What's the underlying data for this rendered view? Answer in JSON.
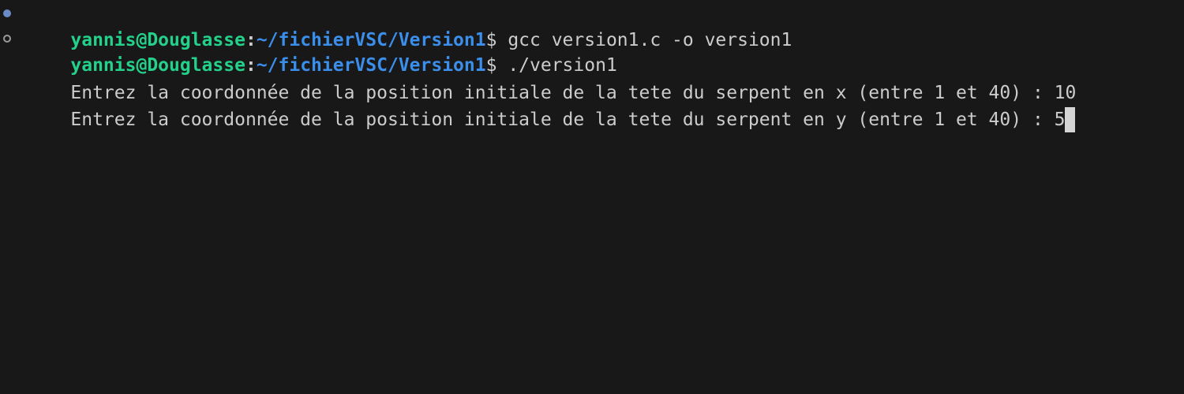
{
  "terminal": {
    "prompt": {
      "user_host": "yannis@Douglasse",
      "separator": ":",
      "path": "~/fichierVSC/Version1",
      "symbol": "$"
    },
    "lines": [
      {
        "kind": "command",
        "command": " gcc version1.c -o version1"
      },
      {
        "kind": "command",
        "command": " ./version1"
      },
      {
        "kind": "output",
        "text": "Entrez la coordonnée de la position initiale de la tete du serpent en x (entre 1 et 40) : 10"
      },
      {
        "kind": "output",
        "text": "Entrez la coordonnée de la position initiale de la tete du serpent en y (entre 1 et 40) : 5"
      }
    ],
    "colors": {
      "background": "#181818",
      "text": "#cccccc",
      "user_host": "#23d18b",
      "path": "#3b8eea",
      "decoration_success": "#6a8bc8",
      "decoration_running": "#9a9a9a",
      "cursor": "#d4d4d4"
    },
    "icons": {
      "command_1_decoration": "circle-filled-icon",
      "command_2_decoration": "circle-outline-icon"
    }
  }
}
